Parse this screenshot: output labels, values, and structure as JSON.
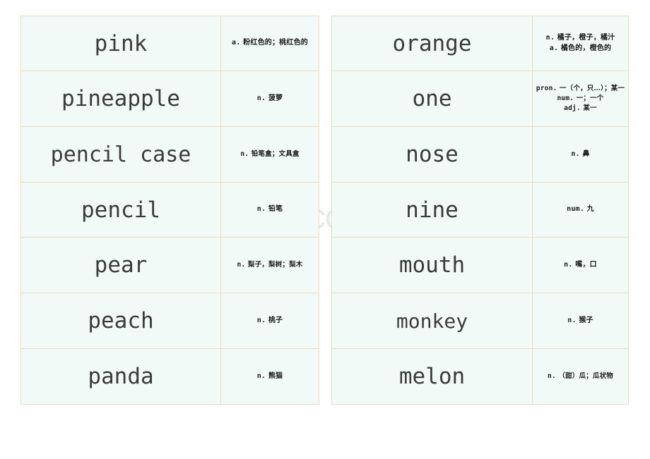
{
  "document": {
    "type": "vocabulary-flashcard-sheet",
    "background_color": "#ffffff",
    "cell_background": "#f2faf7",
    "border_color": "#ecdcba",
    "word_text_color": "#3b3b3b",
    "definition_text_color": "#1a1a1a"
  },
  "watermark": {
    "text": "www.zixin.com.cn",
    "color": "#e2e9e8"
  },
  "tables": [
    {
      "id": "left",
      "rows": [
        {
          "word": "pink",
          "definition": "a. 粉红色的；桃红色的"
        },
        {
          "word": "pineapple",
          "definition": "n. 菠萝"
        },
        {
          "word": "pencil case",
          "definition": "n. 铅笔盒；文具盒"
        },
        {
          "word": "pencil",
          "definition": "n. 铅笔"
        },
        {
          "word": "pear",
          "definition": "n. 梨子，梨树；梨木"
        },
        {
          "word": "peach",
          "definition": "n. 桃子"
        },
        {
          "word": "panda",
          "definition": "n. 熊猫"
        }
      ]
    },
    {
      "id": "right",
      "rows": [
        {
          "word": "orange",
          "definition": "n. 橘子，橙子，橘汁\na. 橘色的，橙色的"
        },
        {
          "word": "one",
          "definition": "pron. 一（个，只…）；某一\nnum. 一；一个\nadj. 某一"
        },
        {
          "word": "nose",
          "definition": "n. 鼻"
        },
        {
          "word": "nine",
          "definition": "num. 九"
        },
        {
          "word": "mouth",
          "definition": "n. 嘴，口"
        },
        {
          "word": "monkey",
          "definition": "n. 猴子"
        },
        {
          "word": "melon",
          "definition": "n. （甜）瓜；瓜状物"
        }
      ]
    }
  ]
}
